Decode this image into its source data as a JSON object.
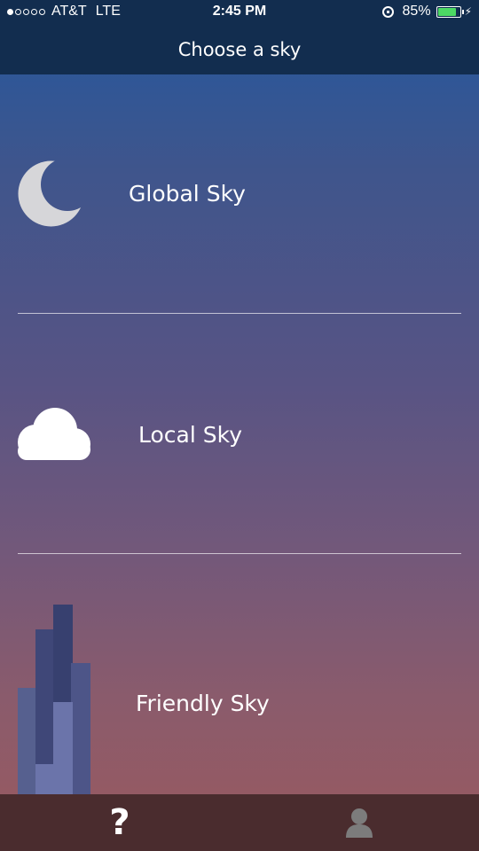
{
  "status_bar": {
    "signal_filled": 1,
    "signal_total": 5,
    "carrier": "AT&T",
    "network": "LTE",
    "time": "2:45 PM",
    "battery_percent": "85%",
    "battery_level": 0.85,
    "battery_color": "#4cd964",
    "icons": [
      "orientation-lock-icon",
      "battery-icon",
      "charging-bolt-icon"
    ]
  },
  "header": {
    "title": "Choose a sky"
  },
  "skies": [
    {
      "label": "Global Sky",
      "icon": "moon-icon"
    },
    {
      "label": "Local Sky",
      "icon": "cloud-icon"
    },
    {
      "label": "Friendly Sky",
      "icon": "buildings-icon"
    }
  ],
  "tab_bar": {
    "help_symbol": "?",
    "help_icon": "help-icon",
    "profile_icon": "profile-icon"
  },
  "colors": {
    "header_bg": "#122d4f",
    "gradient_top": "#23589f",
    "gradient_bottom": "#9a5a5f",
    "tab_bar_bg": "#4a2c2e"
  }
}
